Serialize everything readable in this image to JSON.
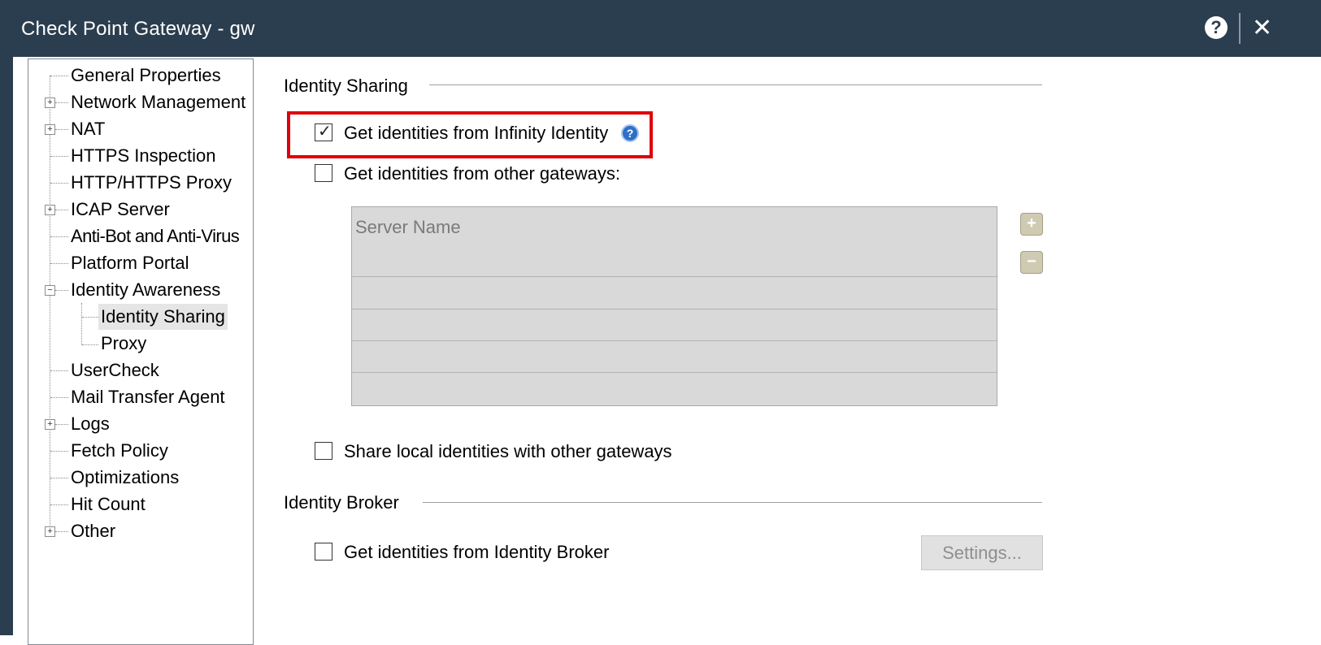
{
  "window": {
    "title": "Check Point Gateway - gw"
  },
  "tree": {
    "items": [
      {
        "label": "General Properties"
      },
      {
        "label": "Network Management"
      },
      {
        "label": "NAT"
      },
      {
        "label": "HTTPS Inspection"
      },
      {
        "label": "HTTP/HTTPS Proxy"
      },
      {
        "label": "ICAP Server"
      },
      {
        "label": "Anti-Bot and Anti-Virus"
      },
      {
        "label": "Platform Portal"
      },
      {
        "label": "Identity Awareness"
      },
      {
        "label": "Identity Sharing"
      },
      {
        "label": "Proxy"
      },
      {
        "label": "UserCheck"
      },
      {
        "label": "Mail Transfer Agent"
      },
      {
        "label": "Logs"
      },
      {
        "label": "Fetch Policy"
      },
      {
        "label": "Optimizations"
      },
      {
        "label": "Hit Count"
      },
      {
        "label": "Other"
      }
    ],
    "selected": "Identity Sharing"
  },
  "identity_sharing": {
    "title": "Identity Sharing",
    "infinity": {
      "label": "Get identities from Infinity Identity",
      "checked": true
    },
    "other_gateways": {
      "label": "Get identities from other gateways:",
      "checked": false
    },
    "grid_header": "Server Name",
    "share_local": {
      "label": "Share local identities with other gateways",
      "checked": false
    }
  },
  "identity_broker": {
    "title": "Identity Broker",
    "broker": {
      "label": "Get identities from Identity Broker",
      "checked": false
    },
    "settings_label": "Settings..."
  },
  "colors": {
    "titlebar": "#2b3e4f",
    "highlight": "#e0000a",
    "info_icon": "#2d6fc9"
  }
}
